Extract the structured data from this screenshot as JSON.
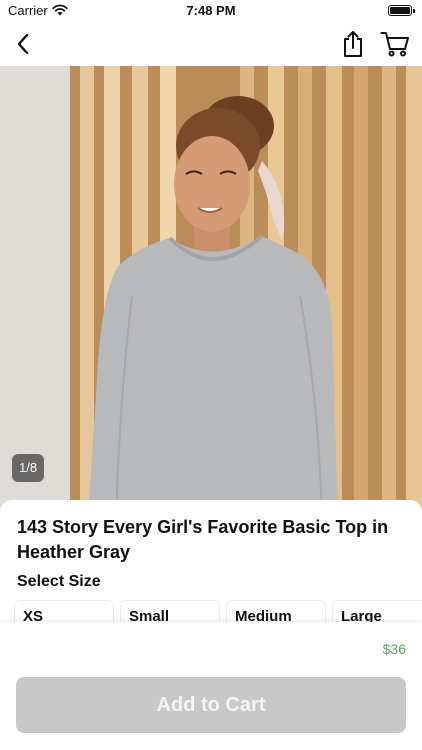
{
  "status_bar": {
    "carrier": "Carrier",
    "time": "7:48 PM"
  },
  "nav": {
    "back_icon": "chevron-left-icon",
    "share_icon": "share-icon",
    "cart_icon": "cart-icon"
  },
  "gallery": {
    "counter": "1/8"
  },
  "product": {
    "title": "143 Story Every Girl's Favorite Basic Top in Heather Gray",
    "size_heading": "Select Size",
    "sizes": [
      {
        "label": "XS"
      },
      {
        "label": "Small"
      },
      {
        "label": "Medium"
      },
      {
        "label": "Large"
      }
    ],
    "price": "$36"
  },
  "actions": {
    "add_to_cart_label": "Add to Cart"
  },
  "colors": {
    "price": "#5aa86a",
    "button_disabled": "#c8c8c8"
  }
}
